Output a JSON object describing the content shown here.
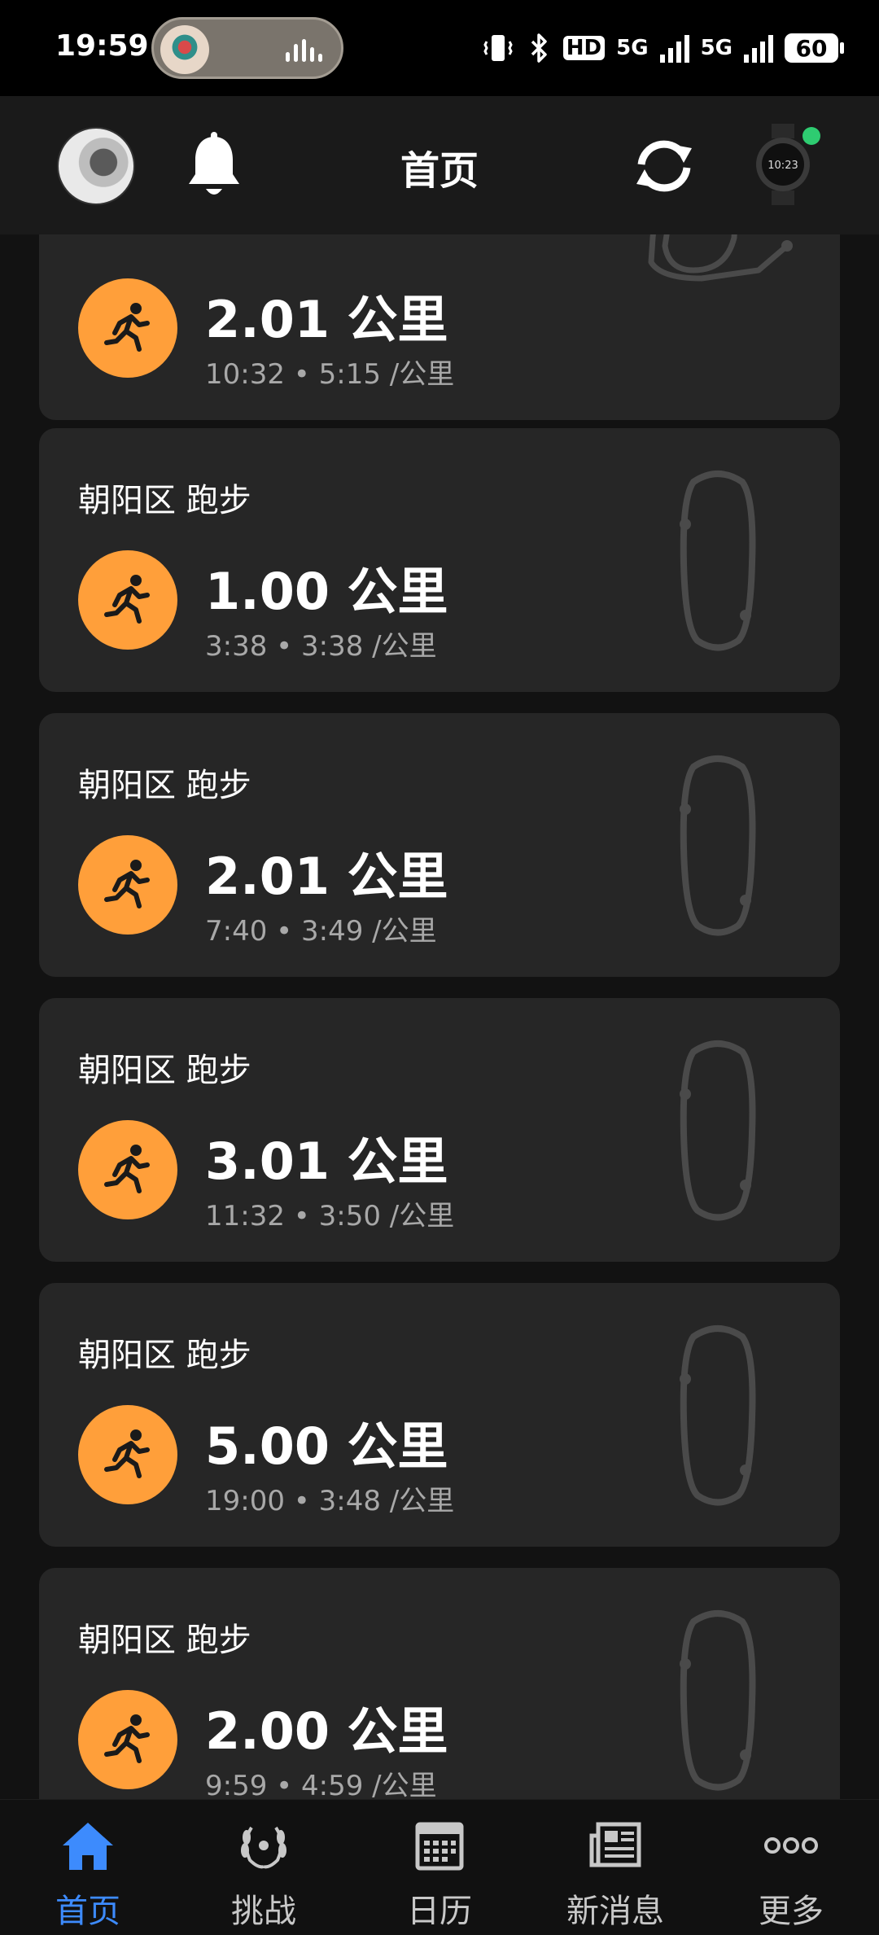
{
  "status_bar": {
    "time": "19:59",
    "hd_label": "HD",
    "net1": "5G",
    "net2": "5G",
    "battery": "60"
  },
  "header": {
    "title": "首页"
  },
  "activities": [
    {
      "location": "",
      "distance": "2.01 公里",
      "meta": "10:32 • 5:15 /公里"
    },
    {
      "location": "朝阳区 跑步",
      "distance": "1.00 公里",
      "meta": "3:38 • 3:38 /公里"
    },
    {
      "location": "朝阳区 跑步",
      "distance": "2.01 公里",
      "meta": "7:40 • 3:49 /公里"
    },
    {
      "location": "朝阳区 跑步",
      "distance": "3.01 公里",
      "meta": "11:32 • 3:50 /公里"
    },
    {
      "location": "朝阳区 跑步",
      "distance": "5.00 公里",
      "meta": "19:00 • 3:48 /公里"
    },
    {
      "location": "朝阳区 跑步",
      "distance": "2.00 公里",
      "meta": "9:59 • 4:59 /公里"
    }
  ],
  "bottom_nav": [
    {
      "label": "首页",
      "icon": "home-icon",
      "active": true
    },
    {
      "label": "挑战",
      "icon": "laurel-icon",
      "active": false
    },
    {
      "label": "日历",
      "icon": "calendar-icon",
      "active": false
    },
    {
      "label": "新消息",
      "icon": "news-icon",
      "active": false
    },
    {
      "label": "更多",
      "icon": "more-icon",
      "active": false
    }
  ],
  "colors": {
    "accent_orange": "#ff9f3a",
    "active_blue": "#3d8bfd",
    "card_bg": "#262626",
    "online_green": "#2ecc71"
  }
}
